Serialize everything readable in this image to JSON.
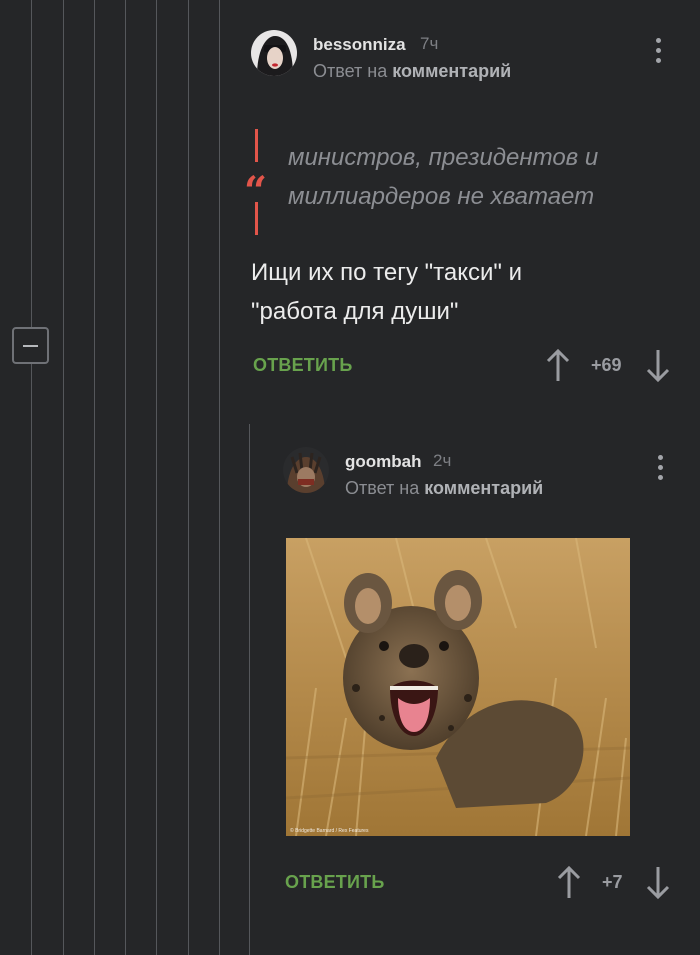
{
  "thread": {
    "comments": [
      {
        "username": "bessonniza",
        "time": "7ч",
        "reply_prefix": "Ответ на",
        "reply_link": "комментарий",
        "quote_mark": "“",
        "quote_lines": [
          "министров, президентов и",
          "миллиардеров не хватает"
        ],
        "text_lines": [
          "Ищи их по тегу \"такси\" и",
          "\"работа для души\""
        ],
        "reply_label": "ОТВЕТИТЬ",
        "rating": "+69"
      },
      {
        "username": "goombah",
        "time": "2ч",
        "reply_prefix": "Ответ на",
        "reply_link": "комментарий",
        "image_caption": "© Bridgette Barnard / Rex Features",
        "reply_label": "ОТВЕТИТЬ",
        "rating": "+7"
      }
    ]
  },
  "icons": {
    "collapse": "minus-icon",
    "more": "more-vertical-icon",
    "upvote": "arrow-up-icon",
    "downvote": "arrow-down-icon"
  },
  "colors": {
    "background": "#252628",
    "accent_green": "#68a24d",
    "quote_red": "#e2554a"
  }
}
